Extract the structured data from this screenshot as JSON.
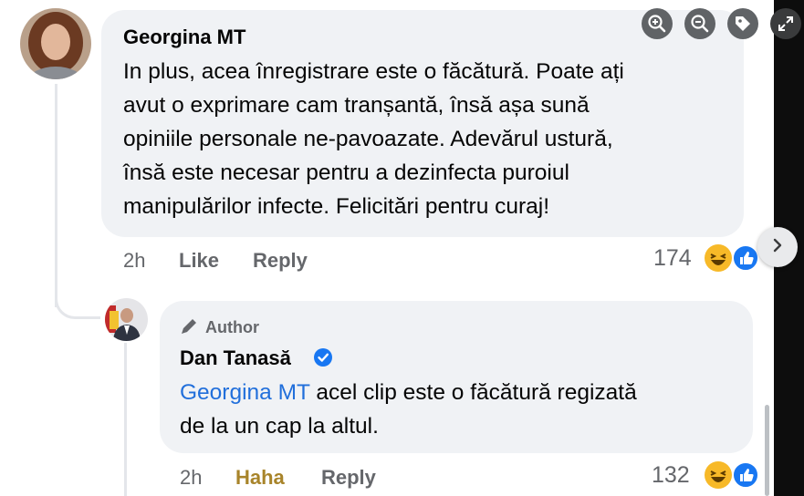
{
  "comment": {
    "author": "Georgina MT",
    "text": "In plus, acea înregistrare este o făcătură. Poate ați\navut o exprimare cam tranșantă, însă așa sună\nopiniile personale ne-pavoazate. Adevărul ustură,\nînsă este necesar pentru a dezinfecta puroiul\nmanipulărilor infecte. Felicitări pentru curaj!",
    "time": "2h",
    "like_label": "Like",
    "reply_label": "Reply",
    "reaction_count": "174",
    "reaction_icons": [
      "haha-reaction-icon",
      "like-reaction-icon"
    ]
  },
  "reply": {
    "badge": "Author",
    "badge_icon": "pencil-icon",
    "author": "Dan Tanasă",
    "verified_icon": "verified-badge-icon",
    "mention": "Georgina MT",
    "text": " acel clip este o făcătură regizată\nde la un cap la altul.",
    "time": "2h",
    "reaction_label": "Haha",
    "reply_label": "Reply",
    "reaction_count": "132",
    "reaction_icons": [
      "haha-reaction-icon",
      "like-reaction-icon"
    ]
  },
  "toolbar": [
    "zoom-in-icon",
    "zoom-out-icon",
    "tag-icon",
    "fullscreen-icon"
  ],
  "colors": {
    "bubble": "#f0f2f5",
    "mention": "#216fdb",
    "meta": "#65676b",
    "haha_label": "#a8842a",
    "verified": "#1877f2"
  }
}
